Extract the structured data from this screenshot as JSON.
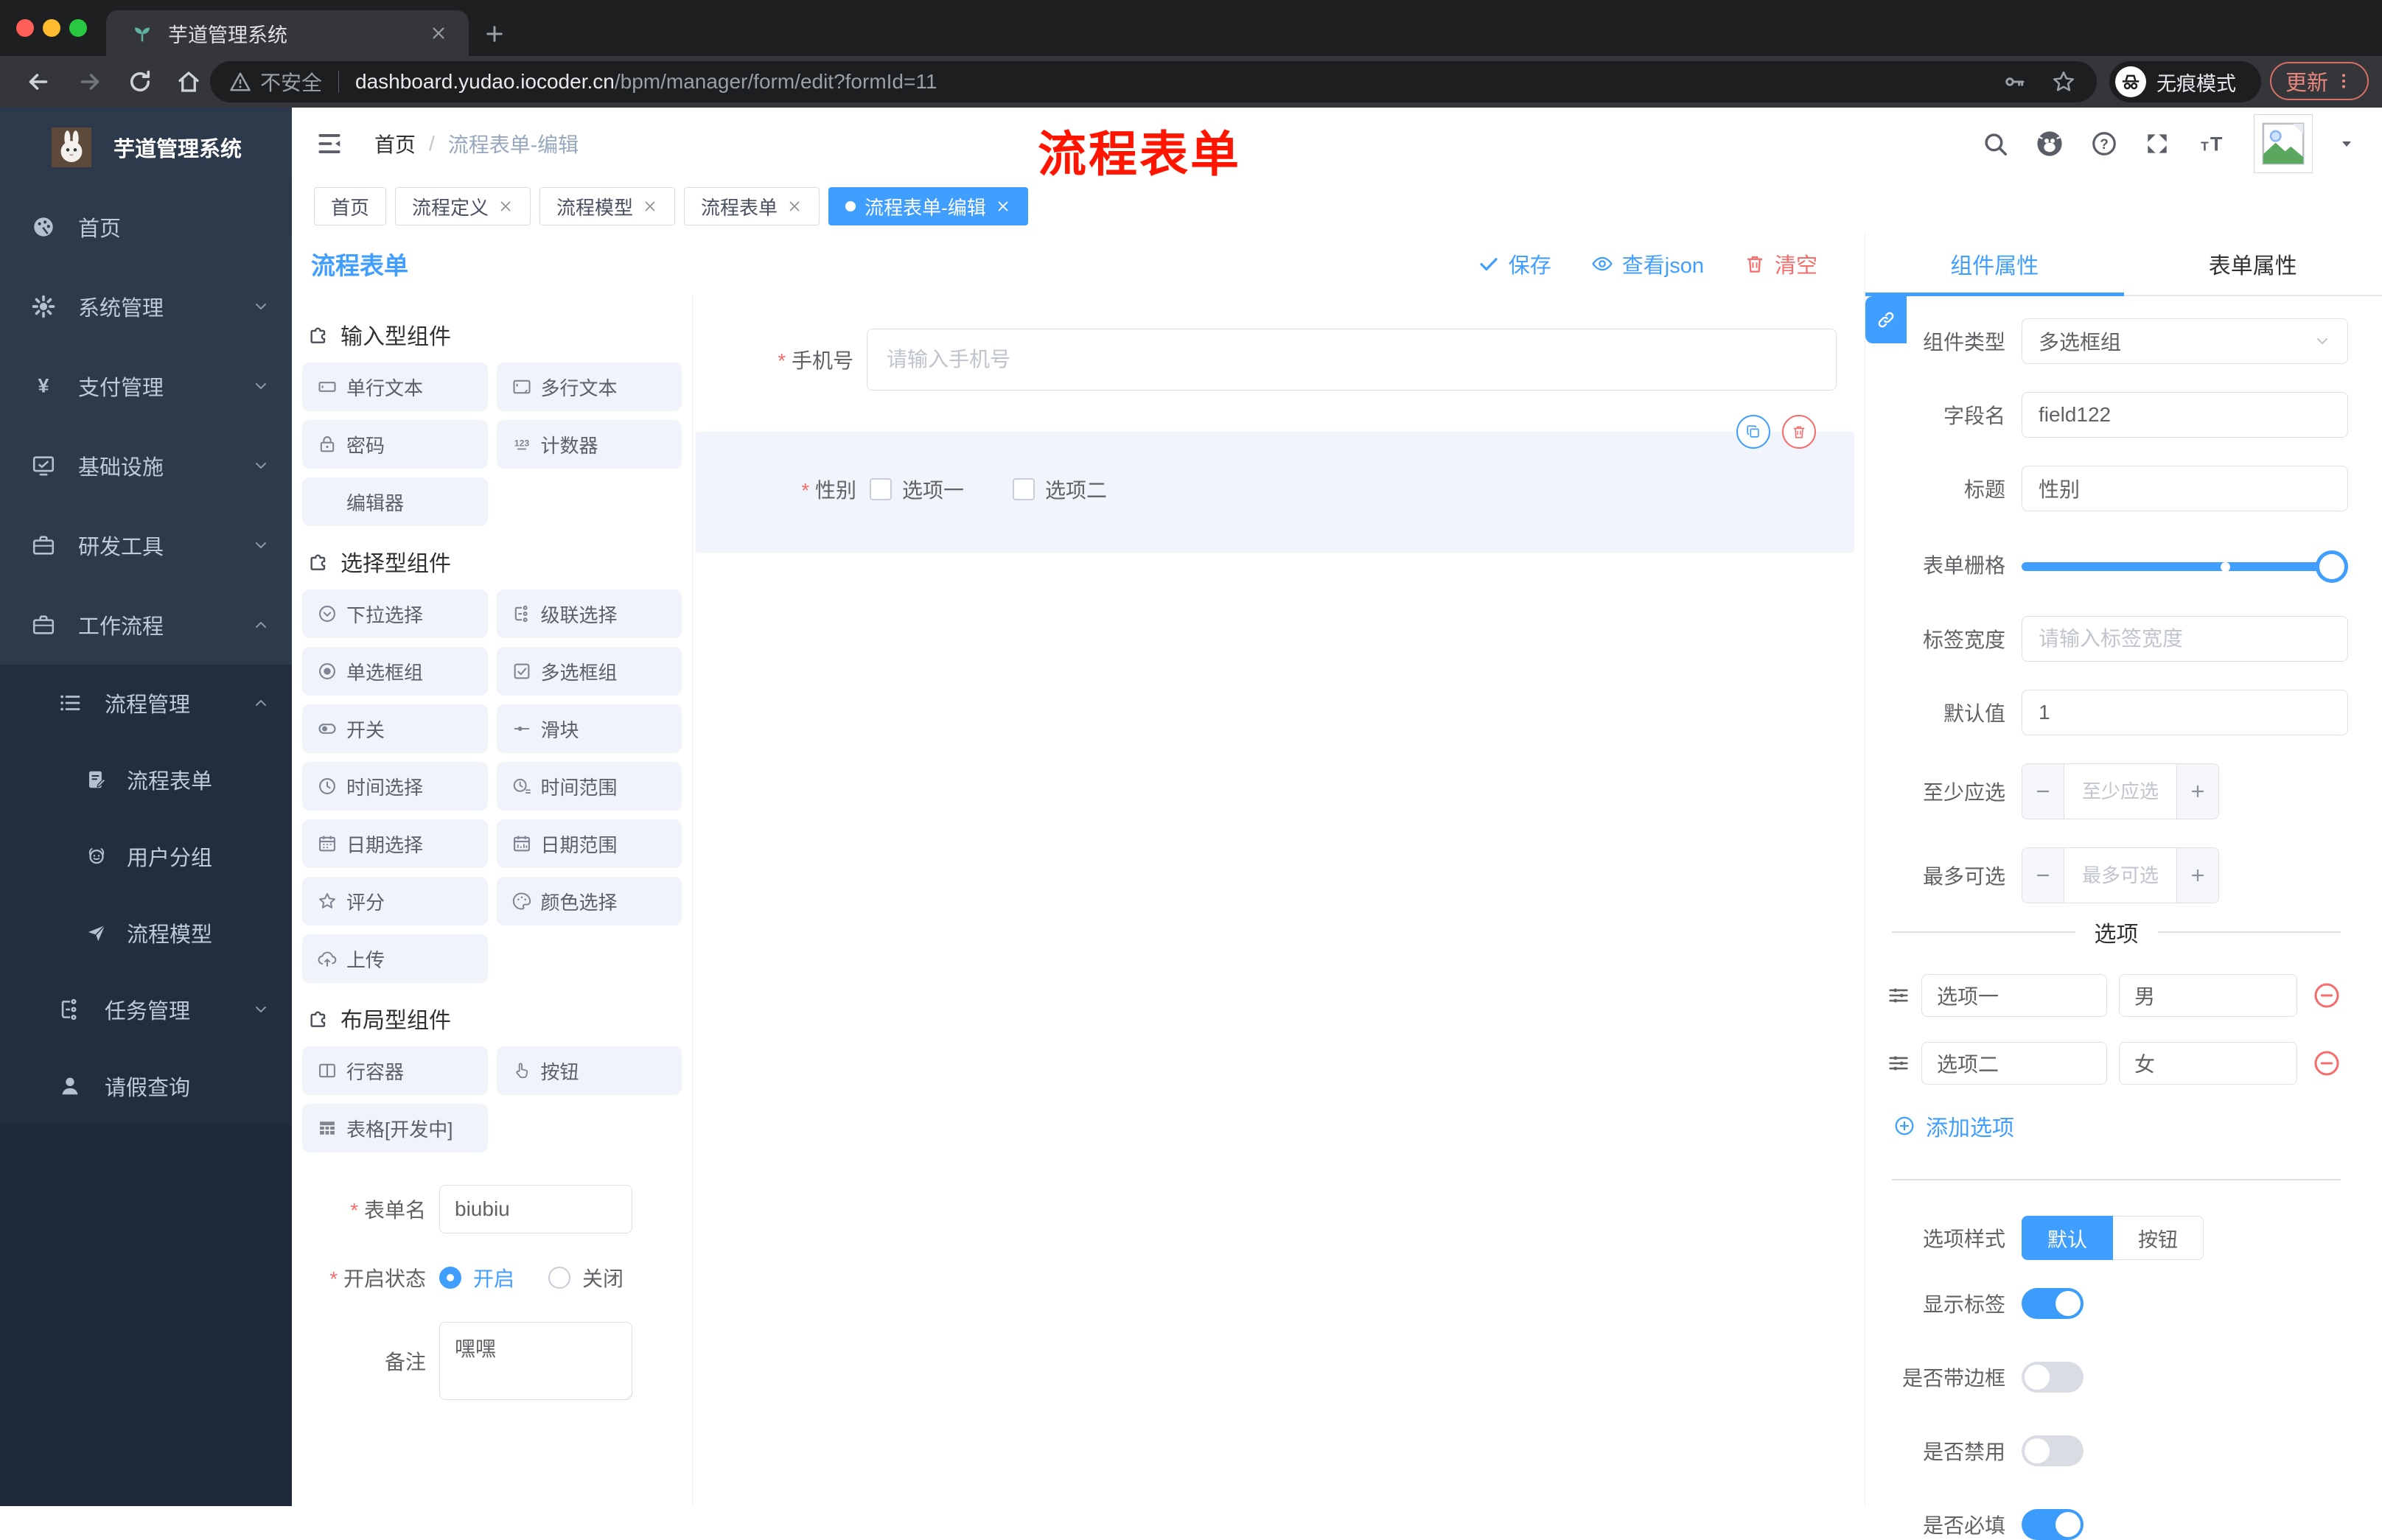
{
  "browser": {
    "tab_title": "芋道管理系统",
    "security": "不安全",
    "url_domain": "dashboard.yudao.iocoder.cn",
    "url_path": "/bpm/manager/form/edit?formId=11",
    "incognito": "无痕模式",
    "update": "更新"
  },
  "annotation": {
    "text": "流程表单",
    "color": "#ff1500"
  },
  "sidebar": {
    "app_title": "芋道管理系统",
    "top_items": [
      {
        "icon": "dashboard",
        "label": "首页"
      },
      {
        "icon": "gear",
        "label": "系统管理",
        "chevron": "down"
      },
      {
        "icon": "yen",
        "label": "支付管理",
        "chevron": "down"
      },
      {
        "icon": "monitor",
        "label": "基础设施",
        "chevron": "down"
      },
      {
        "icon": "briefcase",
        "label": "研发工具",
        "chevron": "down"
      },
      {
        "icon": "briefcase",
        "label": "工作流程",
        "chevron": "up"
      }
    ],
    "sub_items": [
      {
        "icon": "list-settings",
        "label": "流程管理",
        "chevron": "up",
        "level": 1
      },
      {
        "icon": "doc-edit",
        "label": "流程表单",
        "level": 2
      },
      {
        "icon": "robot",
        "label": "用户分组",
        "level": 2
      },
      {
        "icon": "send",
        "label": "流程模型",
        "level": 2
      },
      {
        "icon": "tree",
        "label": "任务管理",
        "chevron": "down",
        "level": 1
      },
      {
        "icon": "user",
        "label": "请假查询",
        "level": 1
      }
    ]
  },
  "header": {
    "breadcrumb": [
      "首页",
      "流程表单-编辑"
    ],
    "separator": "/"
  },
  "tabbar": {
    "tabs": [
      {
        "label": "首页",
        "closable": false,
        "active": false
      },
      {
        "label": "流程定义",
        "closable": true,
        "active": false
      },
      {
        "label": "流程模型",
        "closable": true,
        "active": false
      },
      {
        "label": "流程表单",
        "closable": true,
        "active": false
      },
      {
        "label": "流程表单-编辑",
        "closable": true,
        "active": true
      }
    ]
  },
  "designer": {
    "title": "流程表单",
    "actions": {
      "save": "保存",
      "view_json": "查看json",
      "clear": "清空"
    }
  },
  "components": {
    "sections": [
      {
        "title": "输入型组件",
        "items": [
          {
            "icon": "input",
            "label": "单行文本"
          },
          {
            "icon": "textarea",
            "label": "多行文本"
          },
          {
            "icon": "lock",
            "label": "密码"
          },
          {
            "icon": "counter",
            "label": "计数器"
          },
          {
            "icon": "none",
            "label": "编辑器"
          }
        ]
      },
      {
        "title": "选择型组件",
        "items": [
          {
            "icon": "select",
            "label": "下拉选择"
          },
          {
            "icon": "cascader",
            "label": "级联选择"
          },
          {
            "icon": "radio",
            "label": "单选框组"
          },
          {
            "icon": "checkbox",
            "label": "多选框组"
          },
          {
            "icon": "switch",
            "label": "开关"
          },
          {
            "icon": "slider",
            "label": "滑块"
          },
          {
            "icon": "clock",
            "label": "时间选择"
          },
          {
            "icon": "clock-range",
            "label": "时间范围"
          },
          {
            "icon": "calendar",
            "label": "日期选择"
          },
          {
            "icon": "calendar-range",
            "label": "日期范围"
          },
          {
            "icon": "rate",
            "label": "评分"
          },
          {
            "icon": "palette",
            "label": "颜色选择"
          },
          {
            "icon": "upload",
            "label": "上传"
          }
        ]
      },
      {
        "title": "布局型组件",
        "items": [
          {
            "icon": "row",
            "label": "行容器"
          },
          {
            "icon": "click",
            "label": "按钮"
          },
          {
            "icon": "table",
            "label": "表格[开发中]"
          }
        ]
      }
    ],
    "meta_form": {
      "name_label": "表单名",
      "name_value": "biubiu",
      "status_label": "开启状态",
      "status_on": "开启",
      "status_off": "关闭",
      "remark_label": "备注",
      "remark_value": "嘿嘿"
    }
  },
  "canvas": {
    "phone_label": "手机号",
    "phone_placeholder": "请输入手机号",
    "gender_label": "性别",
    "gender_options": [
      "选项一",
      "选项二"
    ]
  },
  "props": {
    "tabs": [
      "组件属性",
      "表单属性"
    ],
    "component_type_label": "组件类型",
    "component_type_value": "多选框组",
    "field_name_label": "字段名",
    "field_name_value": "field122",
    "title_label": "标题",
    "title_value": "性别",
    "grid_label": "表单栅格",
    "label_width_label": "标签宽度",
    "label_width_placeholder": "请输入标签宽度",
    "default_label": "默认值",
    "default_value": "1",
    "min_label": "至少应选",
    "min_placeholder": "至少应选",
    "max_label": "最多可选",
    "max_placeholder": "最多可选",
    "options_title": "选项",
    "option_rows": [
      {
        "name": "选项一",
        "value": "男"
      },
      {
        "name": "选项二",
        "value": "女"
      }
    ],
    "add_option": "添加选项",
    "style_label": "选项样式",
    "style_choices": [
      "默认",
      "按钮"
    ],
    "style_active": 0,
    "switches": [
      {
        "label": "显示标签",
        "on": true
      },
      {
        "label": "是否带边框",
        "on": false
      },
      {
        "label": "是否禁用",
        "on": false
      },
      {
        "label": "是否必填",
        "on": true
      }
    ]
  },
  "colors": {
    "primary": "#409eff",
    "danger": "#f56c6c",
    "sidebar": "#2d3a4b",
    "sidebar_dark": "#222e3e"
  }
}
